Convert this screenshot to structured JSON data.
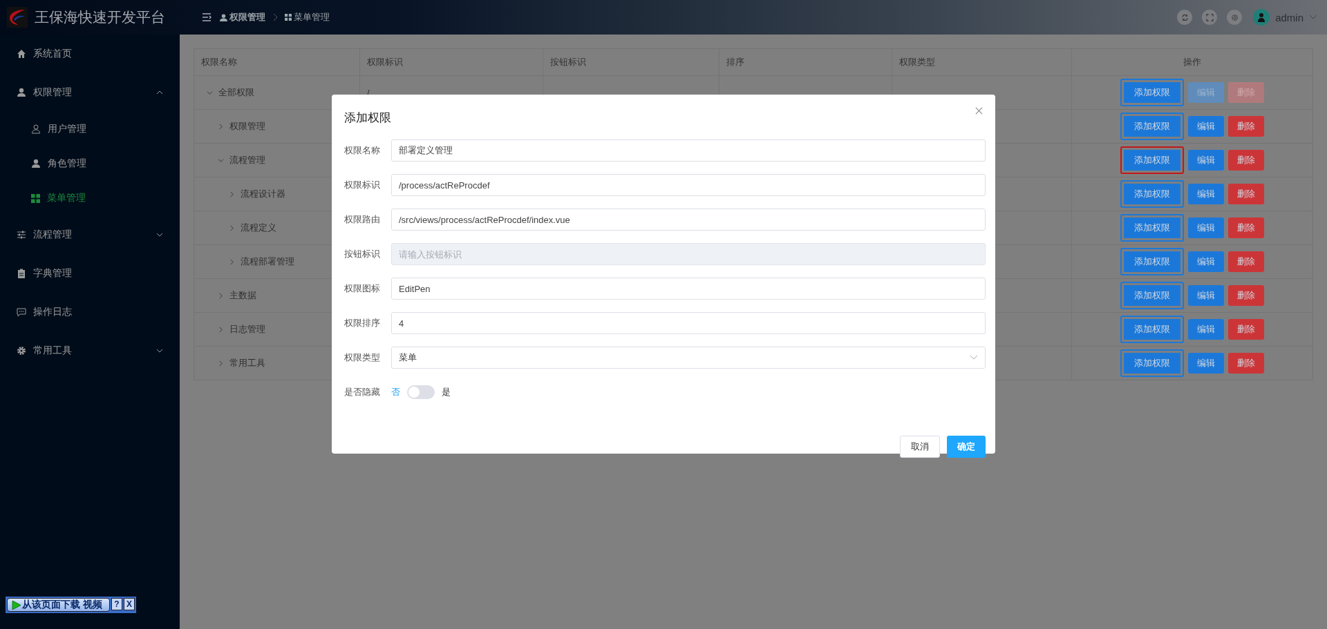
{
  "app": {
    "title": "王保海快速开发平台"
  },
  "header": {
    "breadcrumb": [
      {
        "label": "权限管理"
      },
      {
        "label": "菜单管理"
      }
    ],
    "user": {
      "name": "admin"
    }
  },
  "sidebar": {
    "items": [
      {
        "label": "系统首页",
        "selected": false
      },
      {
        "label": "权限管理",
        "selected": false,
        "expanded": true,
        "children": [
          {
            "label": "用户管理",
            "selected": false
          },
          {
            "label": "角色管理",
            "selected": false
          },
          {
            "label": "菜单管理",
            "selected": true
          }
        ]
      },
      {
        "label": "流程管理",
        "selected": false,
        "expanded": false
      },
      {
        "label": "字典管理",
        "selected": false
      },
      {
        "label": "操作日志",
        "selected": false
      },
      {
        "label": "常用工具",
        "selected": false,
        "expanded": false
      }
    ]
  },
  "table": {
    "columns": [
      "权限名称",
      "权限标识",
      "按钮标识",
      "排序",
      "权限类型",
      "操作"
    ],
    "rows": [
      {
        "name": "全部权限",
        "identifier": "/",
        "expanded": true,
        "actions": [
          {
            "label": "添加权限",
            "disabled": false,
            "highlighted": false
          },
          {
            "label": "编辑",
            "disabled": true
          },
          {
            "label": "删除",
            "disabled": true
          }
        ],
        "children": [
          {
            "name": "权限管理",
            "expanded": false,
            "actions": [
              {
                "label": "添加权限",
                "disabled": false,
                "highlighted": false
              },
              {
                "label": "编辑",
                "disabled": false
              },
              {
                "label": "删除",
                "disabled": false
              }
            ]
          },
          {
            "name": "流程管理",
            "expanded": true,
            "actions": [
              {
                "label": "添加权限",
                "disabled": false,
                "highlighted": true
              },
              {
                "label": "编辑",
                "disabled": false
              },
              {
                "label": "删除",
                "disabled": false
              }
            ],
            "children": [
              {
                "name": "流程设计器",
                "expanded": false,
                "actions": [
                  {
                    "label": "添加权限",
                    "disabled": false,
                    "highlighted": false
                  },
                  {
                    "label": "编辑",
                    "disabled": false
                  },
                  {
                    "label": "删除",
                    "disabled": false
                  }
                ]
              },
              {
                "name": "流程定义",
                "expanded": false,
                "actions": [
                  {
                    "label": "添加权限",
                    "disabled": false,
                    "highlighted": false
                  },
                  {
                    "label": "编辑",
                    "disabled": false
                  },
                  {
                    "label": "删除",
                    "disabled": false
                  }
                ]
              },
              {
                "name": "流程部署管理",
                "expanded": false,
                "actions": [
                  {
                    "label": "添加权限",
                    "disabled": false,
                    "highlighted": false
                  },
                  {
                    "label": "编辑",
                    "disabled": false
                  },
                  {
                    "label": "删除",
                    "disabled": false
                  }
                ]
              }
            ]
          },
          {
            "name": "主数据",
            "expanded": false,
            "actions": [
              {
                "label": "添加权限",
                "disabled": false,
                "highlighted": false
              },
              {
                "label": "编辑",
                "disabled": false
              },
              {
                "label": "删除",
                "disabled": false
              }
            ]
          },
          {
            "name": "日志管理",
            "expanded": false,
            "actions": [
              {
                "label": "添加权限",
                "disabled": false,
                "highlighted": false
              },
              {
                "label": "编辑",
                "disabled": false
              },
              {
                "label": "删除",
                "disabled": false
              }
            ]
          },
          {
            "name": "常用工具",
            "expanded": false,
            "actions": [
              {
                "label": "添加权限",
                "disabled": false,
                "highlighted": false
              },
              {
                "label": "编辑",
                "disabled": false
              },
              {
                "label": "删除",
                "disabled": false
              }
            ]
          }
        ]
      }
    ]
  },
  "dialog": {
    "title": "添加权限",
    "fields": [
      {
        "kind": "input",
        "label": "权限名称",
        "value": "部署定义管理"
      },
      {
        "kind": "input",
        "label": "权限标识",
        "value": "/process/actReProcdef"
      },
      {
        "kind": "input",
        "label": "权限路由",
        "value": "/src/views/process/actReProcdef/index.vue"
      },
      {
        "kind": "input",
        "label": "按钮标识",
        "placeholder": "请输入按钮标识",
        "disabled": true
      },
      {
        "kind": "input",
        "label": "权限图标",
        "value": "EditPen"
      },
      {
        "kind": "input",
        "label": "权限排序",
        "value": "4"
      },
      {
        "kind": "select",
        "label": "权限类型",
        "value": "菜单"
      },
      {
        "kind": "switch",
        "label": "是否隐藏",
        "off_label": "否",
        "on_label": "是",
        "on": false
      }
    ],
    "buttons": {
      "cancel": "取消",
      "confirm": "确定"
    }
  },
  "download_bar": {
    "label": "从该页面下载 视频",
    "help": "?",
    "close": "X"
  }
}
